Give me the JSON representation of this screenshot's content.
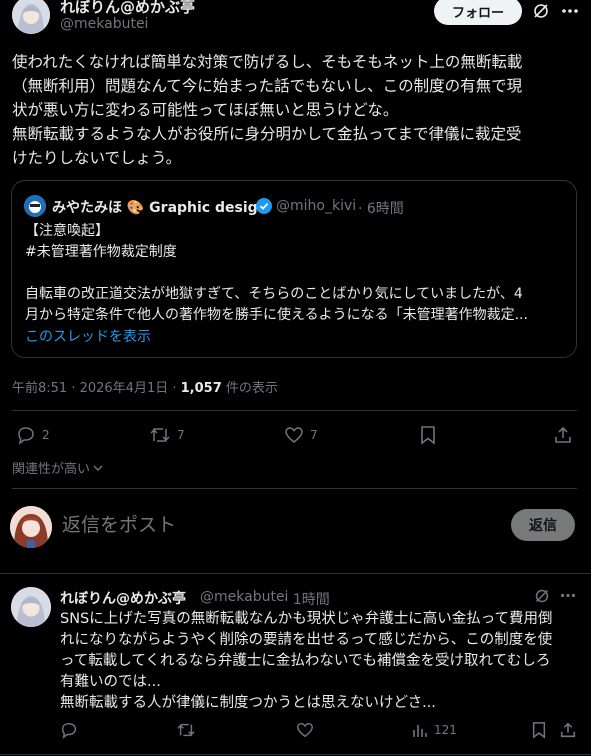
{
  "main_post": {
    "author_name": "れぼりん@めかぶ亭",
    "handle": "@mekabutei",
    "follow_label": "フォロー",
    "body": [
      "使われたくなければ簡単な対策で防げるし、そもそもネット上の無断転載",
      "（無断利用）問題なんて今に始まった話でもないし、この制度の有無で現",
      "状が悪い方に変わる可能性ってほぼ無いと思うけどな。",
      "無断転載するような人がお役所に身分明かして金払ってまで律儀に裁定受",
      "けたりしないでしょう。"
    ],
    "timestamp": "午前8:51 · 2026年4月1日 · ",
    "views_count": "1,057",
    "views_label": " 件の表示",
    "replies": "2",
    "reposts": "7",
    "likes": "7"
  },
  "quoted_post": {
    "author_name": "みやたみほ 🎨 Graphic design",
    "handle": "@miho_kivi",
    "time": "· 6時間",
    "lines": [
      "【注意喚起】",
      "#未管理著作物裁定制度",
      "",
      "自転車の改正道交法が地獄すぎて、そちらのことばかり気にしていましたが、4",
      "月から特定条件で他人の著作物を勝手に使えるようになる「未管理著作物裁定..."
    ],
    "thread_link": "このスレッドを表示"
  },
  "sort_label": "関連性が高い",
  "composer": {
    "placeholder": "返信をポスト",
    "reply_button": "返信"
  },
  "reply_post": {
    "author_name": "れぼりん@めかぶ亭",
    "handle": "@mekabutei",
    "time": "· 1時間",
    "body": [
      "SNSに上げた写真の無断転載なんかも現状じゃ弁護士に高い金払って費用倒",
      "れになりながらようやく削除の要請を出せるって感じだから、この制度を使",
      "って転載してくれるなら弁護士に金払わないでも補償金を受け取れてむしろ",
      "有難いのでは...",
      "無断転載する人が律儀に制度つかうとは思えないけどさ..."
    ],
    "views": "121"
  },
  "colors": {
    "background": "#000000",
    "text": "#e7e9ea",
    "muted": "#71767b",
    "link": "#1d9bf0",
    "border": "#2f3336"
  }
}
